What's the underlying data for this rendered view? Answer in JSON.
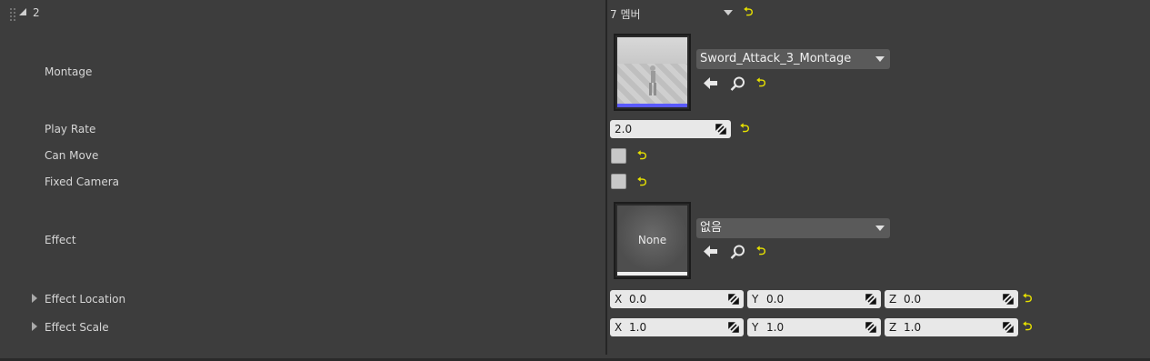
{
  "header": {
    "index_label": "2",
    "members_label": "7 멤버"
  },
  "properties": {
    "montage": {
      "label": "Montage",
      "asset_name": "Sword_Attack_3_Montage"
    },
    "play_rate": {
      "label": "Play Rate",
      "value": "2.0"
    },
    "can_move": {
      "label": "Can Move",
      "checked": false
    },
    "fixed_camera": {
      "label": "Fixed Camera",
      "checked": false
    },
    "effect": {
      "label": "Effect",
      "asset_name": "없음",
      "thumbnail_text": "None"
    },
    "effect_location": {
      "label": "Effect Location",
      "x_axis": "X",
      "x": "0.0",
      "y_axis": "Y",
      "y": "0.0",
      "z_axis": "Z",
      "z": "0.0"
    },
    "effect_scale": {
      "label": "Effect Scale",
      "x_axis": "X",
      "x": "1.0",
      "y_axis": "Y",
      "y": "1.0",
      "z_axis": "Z",
      "z": "1.0"
    }
  },
  "icons": {
    "reset": "reset-to-default-icon",
    "browse": "arrow-left-icon",
    "find": "magnifier-icon"
  },
  "colors": {
    "panel_bg": "#3d3d3d",
    "reset_yellow": "#e6e000",
    "montage_bar": "#5a5aff"
  }
}
